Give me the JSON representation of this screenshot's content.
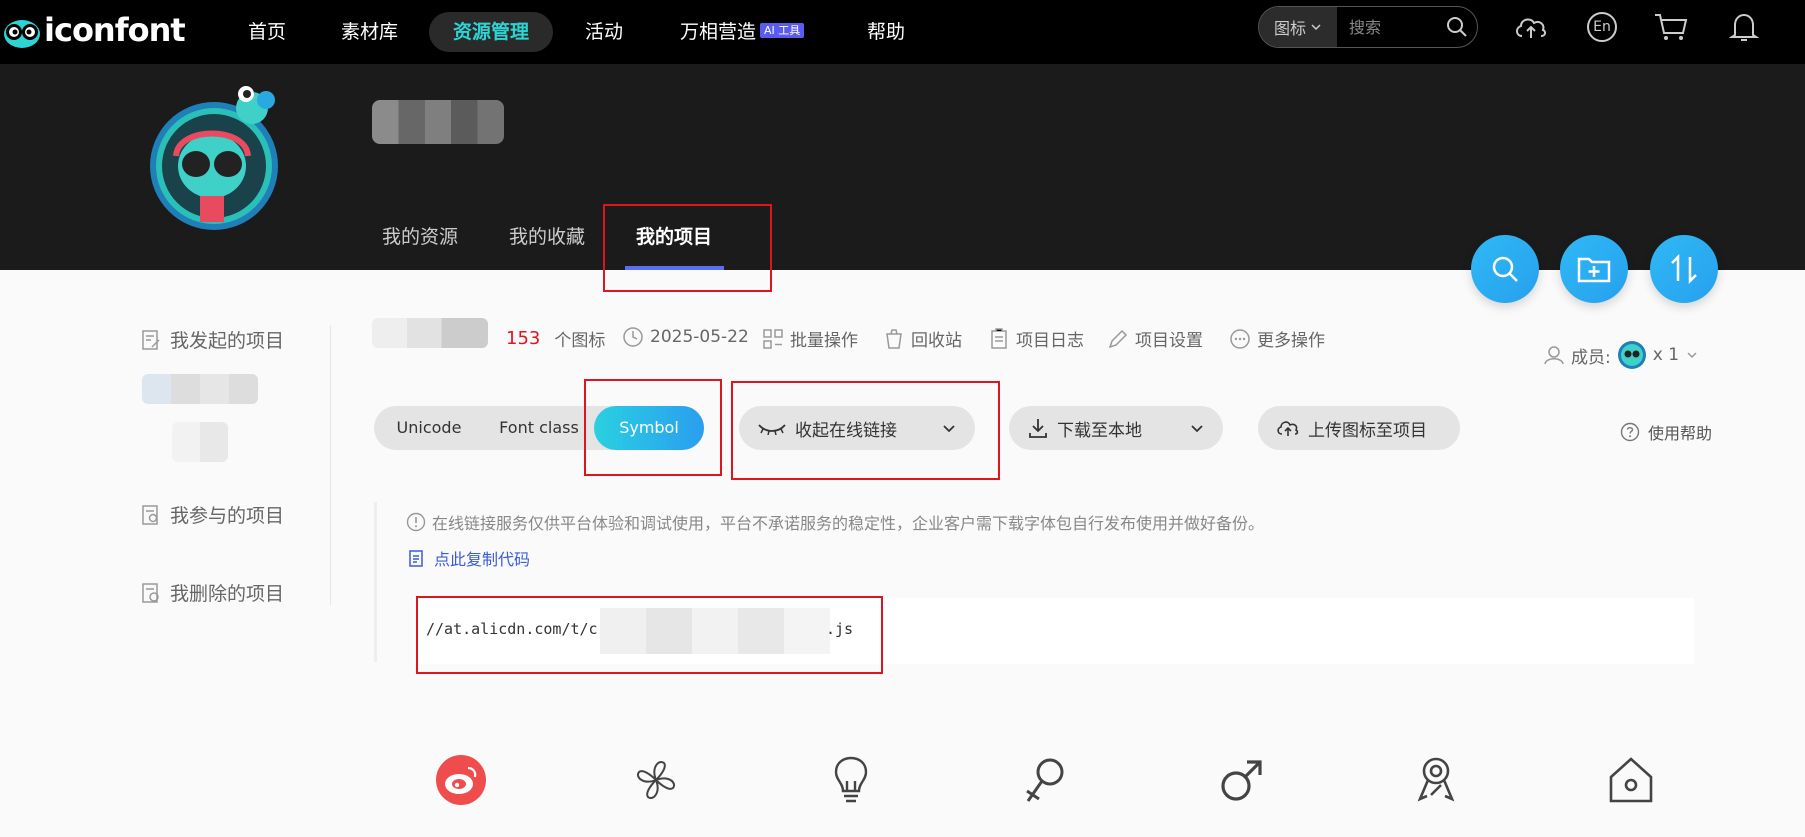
{
  "nav": {
    "logo_text": "iconfont",
    "items": [
      {
        "label": "首页"
      },
      {
        "label": "素材库"
      },
      {
        "label": "资源管理"
      },
      {
        "label": "活动"
      },
      {
        "label": "万相营造"
      },
      {
        "label": "帮助"
      }
    ],
    "ai_badge": "AI 工具",
    "search_type": "图标",
    "search_placeholder": "搜索",
    "lang_label": "En"
  },
  "profile": {
    "tabs": [
      {
        "label": "我的资源"
      },
      {
        "label": "我的收藏"
      },
      {
        "label": "我的项目"
      }
    ]
  },
  "sidebar": {
    "items": [
      {
        "label": "我发起的项目"
      },
      {
        "label": "我参与的项目"
      },
      {
        "label": "我删除的项目"
      }
    ]
  },
  "project": {
    "icon_count": "153",
    "icon_count_unit": "个图标",
    "date": "2025-05-22",
    "actions": [
      {
        "label": "批量操作"
      },
      {
        "label": "回收站"
      },
      {
        "label": "项目日志"
      },
      {
        "label": "项目设置"
      },
      {
        "label": "更多操作"
      }
    ],
    "members_label": "成员:",
    "members_count": "x 1"
  },
  "format_tabs": [
    {
      "label": "Unicode"
    },
    {
      "label": "Font class"
    },
    {
      "label": "Symbol"
    }
  ],
  "buttons": {
    "collapse_link": "收起在线链接",
    "download": "下载至本地",
    "upload": "上传图标至项目",
    "help": "使用帮助"
  },
  "notice": {
    "text": "在线链接服务仅供平台体验和调试使用，平台不承诺服务的稳定性，企业客户需下载字体包自行发布使用并做好备份。",
    "copy_label": "点此复制代码"
  },
  "code": {
    "prefix": "//at.alicdn.com/t/c",
    "suffix": ".js"
  },
  "colors": {
    "accent_cyan": "#2dd4d4",
    "accent_blue": "#2a9ef0",
    "count_red": "#e0141e",
    "link_blue": "#3b5bdb",
    "highlight_red": "#e0141e"
  },
  "icons": [
    "weibo-icon",
    "fan-icon",
    "lightbulb-icon",
    "female-icon",
    "male-icon",
    "award-icon",
    "home-icon"
  ]
}
